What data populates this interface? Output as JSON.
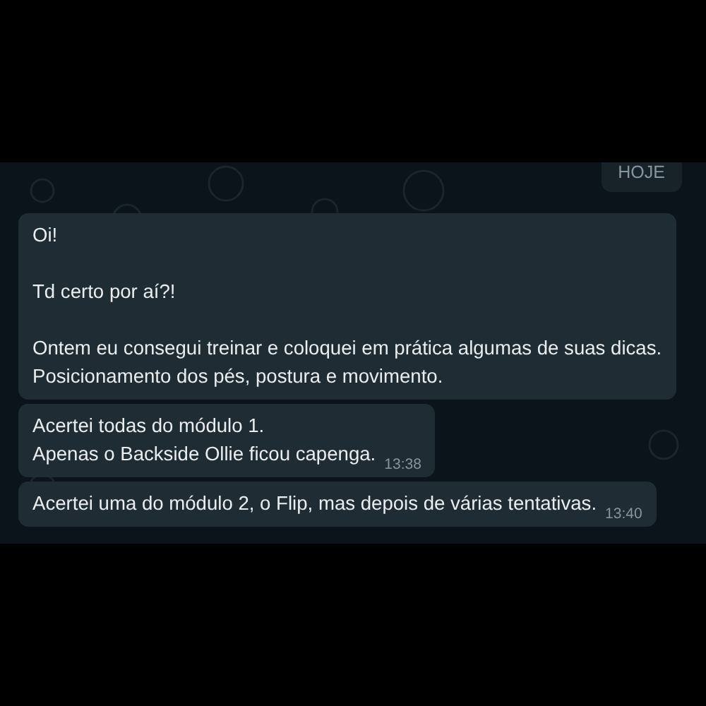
{
  "date_badge": "HOJE",
  "messages": [
    {
      "paragraphs": [
        [
          "Oi!"
        ],
        [
          "Td certo por aí?!"
        ],
        [
          "Ontem eu consegui treinar e coloquei em prática algumas de suas dicas.",
          "Posicionamento dos pés, postura e movimento."
        ]
      ]
    },
    {
      "paragraphs": [
        [
          "Acertei todas do módulo 1.",
          "Apenas o Backside Ollie ficou capenga."
        ]
      ],
      "time": "13:38"
    },
    {
      "paragraphs": [
        [
          "Acertei uma do módulo 2, o Flip, mas depois de várias tentativas."
        ]
      ],
      "time": "13:40"
    }
  ]
}
